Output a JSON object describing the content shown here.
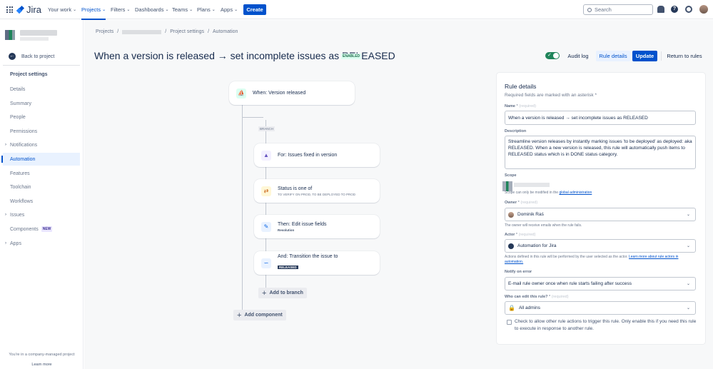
{
  "topnav": {
    "logo": "Jira",
    "items": [
      {
        "label": "Your work"
      },
      {
        "label": "Projects",
        "active": true
      },
      {
        "label": "Filters"
      },
      {
        "label": "Dashboards"
      },
      {
        "label": "Teams"
      },
      {
        "label": "Plans"
      },
      {
        "label": "Apps"
      }
    ],
    "create_label": "Create",
    "search_placeholder": "Search",
    "help_glyph": "?"
  },
  "sidebar": {
    "back_label": "Back to project",
    "heading": "Project settings",
    "items": [
      {
        "label": "Details"
      },
      {
        "label": "Summary"
      },
      {
        "label": "People"
      },
      {
        "label": "Permissions"
      },
      {
        "label": "Notifications",
        "expandable": true
      },
      {
        "label": "Automation",
        "active": true
      },
      {
        "label": "Features"
      },
      {
        "label": "Toolchain"
      },
      {
        "label": "Workflows"
      },
      {
        "label": "Issues",
        "expandable": true
      },
      {
        "label": "Components",
        "badge": "NEW"
      },
      {
        "label": "Apps",
        "expandable": true
      }
    ],
    "footer_text": "You're in a company-managed project",
    "footer_link": "Learn more"
  },
  "breadcrumb": {
    "items": [
      "Projects",
      "Project settings",
      "Automation"
    ],
    "separator": "/"
  },
  "header": {
    "title": "When a version is released → set incomplete issues as RELEASED",
    "status": "ENABLED",
    "toggle_on": true,
    "audit_log": "Audit log",
    "rule_details": "Rule details",
    "update": "Update",
    "return": "Return to rules"
  },
  "flow": {
    "trigger": {
      "title": "When: Version released",
      "icon": "ship-icon"
    },
    "branch_tag": "BRANCH",
    "branch": {
      "title": "For: Issues fixed in version",
      "icon": "hierarchy-icon"
    },
    "condition": {
      "title": "Status is one of",
      "sub": "TO VERIFY ON PROD, TO BE DEPLOYED TO PROD",
      "icon": "shuffle-icon"
    },
    "edit": {
      "title": "Then: Edit issue fields",
      "sub": "Resolution",
      "icon": "pencil-icon"
    },
    "transition": {
      "title": "And: Transition the issue to",
      "lozenge": "RELEASED",
      "icon": "transition-icon"
    },
    "add_to_branch": "Add to branch",
    "add_component": "Add component"
  },
  "panel": {
    "title": "Rule details",
    "required_note": "Required fields are marked with an asterisk *",
    "name_label": "Name",
    "required_hint": "(required)",
    "name_value": "When a version is released → set incomplete issues as RELEASED",
    "description_label": "Description",
    "description_value": "Streamline version releases by instantly marking issues 'to be deployed' as  deployed: aka  RELEASED. When a new version is released, this rule will automatically push items to RELEASED status which is in DONE status category.",
    "scope_label": "Scope",
    "scope_hint_pre": "Scope can only be modified in the ",
    "scope_hint_link": "global administration",
    "owner_label": "Owner",
    "owner_value": "Dominik Raś",
    "owner_hint": "The owner will receive emails when the rule fails.",
    "actor_label": "Actor",
    "actor_value": "Automation for Jira",
    "actor_hint_pre": "Actions defined in this rule will be performed by the user selected as the actor. ",
    "actor_hint_link": "Learn more about rule actors in automation.",
    "notify_label": "Notify on error",
    "notify_value": "E-mail rule owner once when rule starts failing after success",
    "edit_label": "Who can edit this rule?",
    "edit_value": "All admins",
    "checkbox_label": "Check to allow other rule actions to trigger this rule. Only enable this if you need this rule to execute in response to another rule.",
    "checkbox_checked": false
  },
  "colors": {
    "brand": "#0052cc",
    "enabled_green": "#1f845a",
    "text": "#172b4d"
  }
}
